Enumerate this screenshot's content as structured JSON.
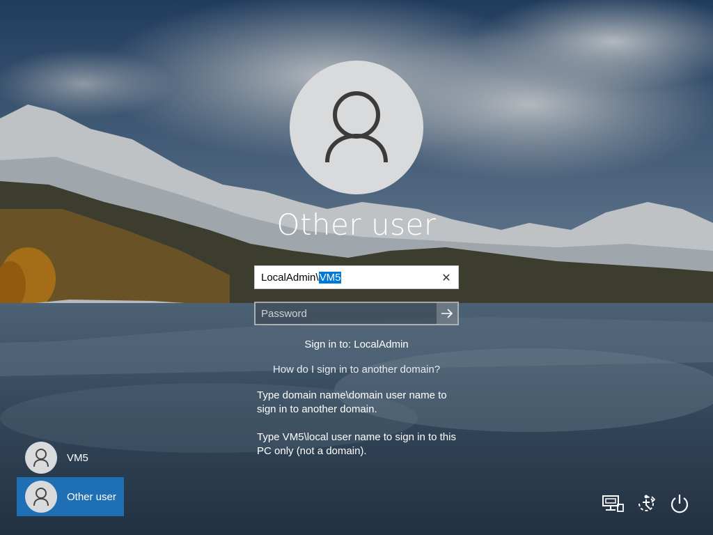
{
  "login": {
    "title": "Other user",
    "username_prefix": "LocalAdmin",
    "username_selected": "VM5",
    "clear_symbol": "✕",
    "password_placeholder": "Password",
    "submit_icon": "arrow-right-icon",
    "signin_to": "Sign in to: LocalAdmin",
    "help_link": "How do I sign in to another domain?",
    "hint_domain": "Type domain name\\domain user name to sign in to another domain.",
    "hint_local": "Type VM5\\local user name to sign in to this PC only (not a domain)."
  },
  "users": [
    {
      "label": "VM5",
      "selected": false
    },
    {
      "label": "Other user",
      "selected": true
    }
  ],
  "system_icons": [
    "network-icon",
    "ease-of-access-icon",
    "power-icon"
  ],
  "colors": {
    "accent": "#0078d7",
    "selected_tile": "#1f6fb5",
    "avatar_bg": "#d9dadc"
  }
}
